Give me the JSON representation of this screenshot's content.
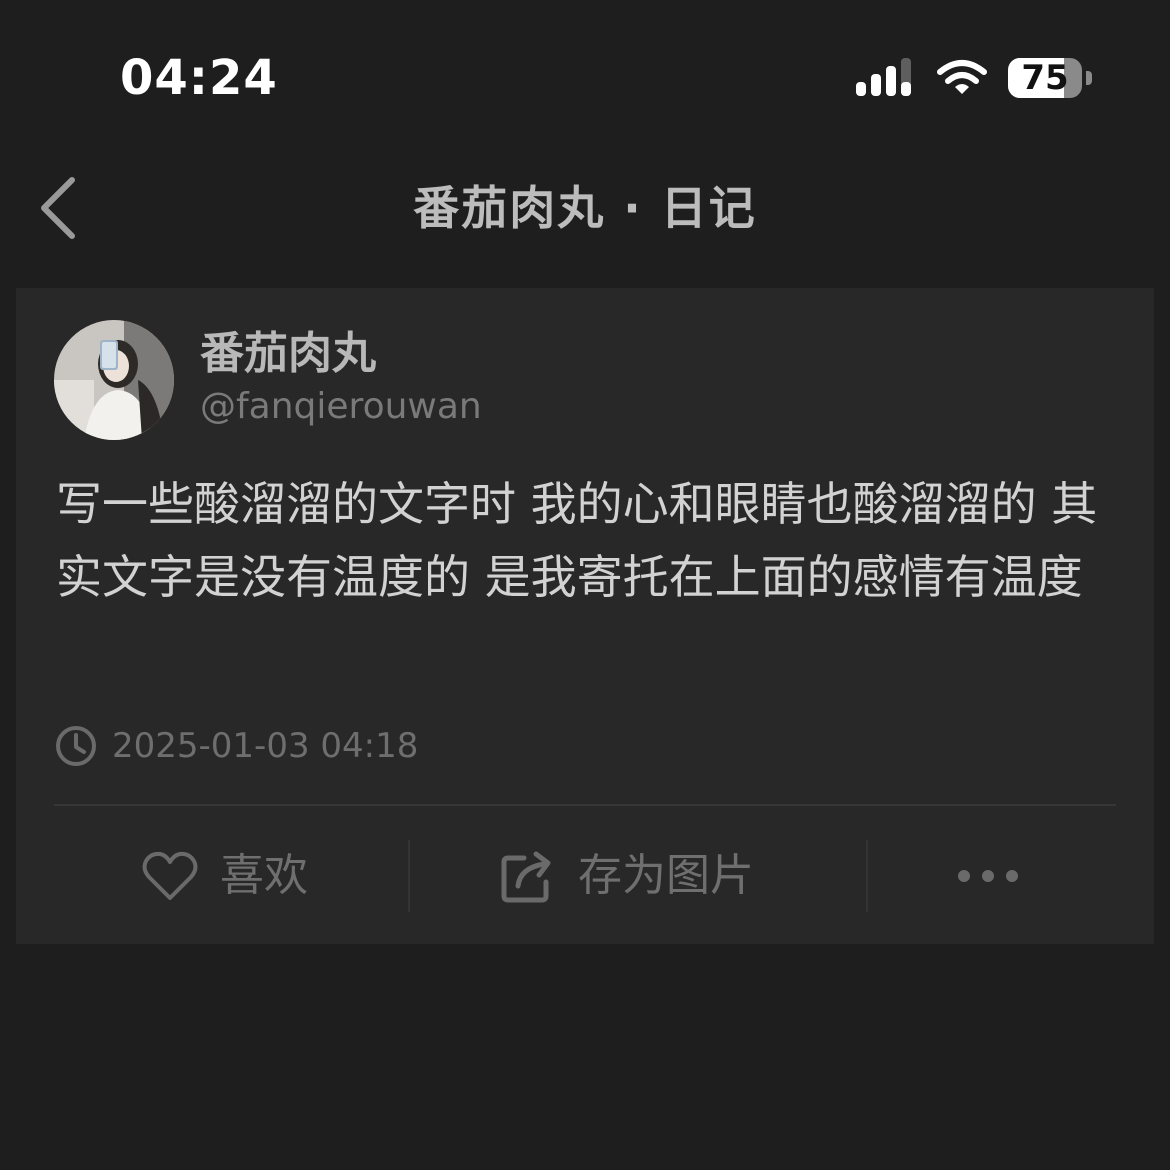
{
  "status_bar": {
    "time": "04:24",
    "battery_level": "75",
    "signal_icon": "signal-icon",
    "wifi_icon": "wifi-icon",
    "battery_icon": "battery-icon"
  },
  "header": {
    "back_icon": "chevron-left-icon",
    "title": "番茄肉丸 · 日记"
  },
  "post": {
    "author_name": "番茄肉丸",
    "author_handle": "@fanqierouwan",
    "text": "写一些酸溜溜的文字时 我的心和眼睛也酸溜溜的 其实文字是没有温度的 是我寄托在上面的感情有温度",
    "timestamp": "2025-01-03 04:18"
  },
  "actions": {
    "like_label": "喜欢",
    "save_label": "存为图片",
    "like_icon": "heart-icon",
    "save_icon": "share-image-icon",
    "more_icon": "more-icon"
  },
  "colors": {
    "background": "#1e1e1e",
    "card": "#282828",
    "primary_text": "#d2d2d2",
    "secondary_text": "#6e6e6e"
  }
}
